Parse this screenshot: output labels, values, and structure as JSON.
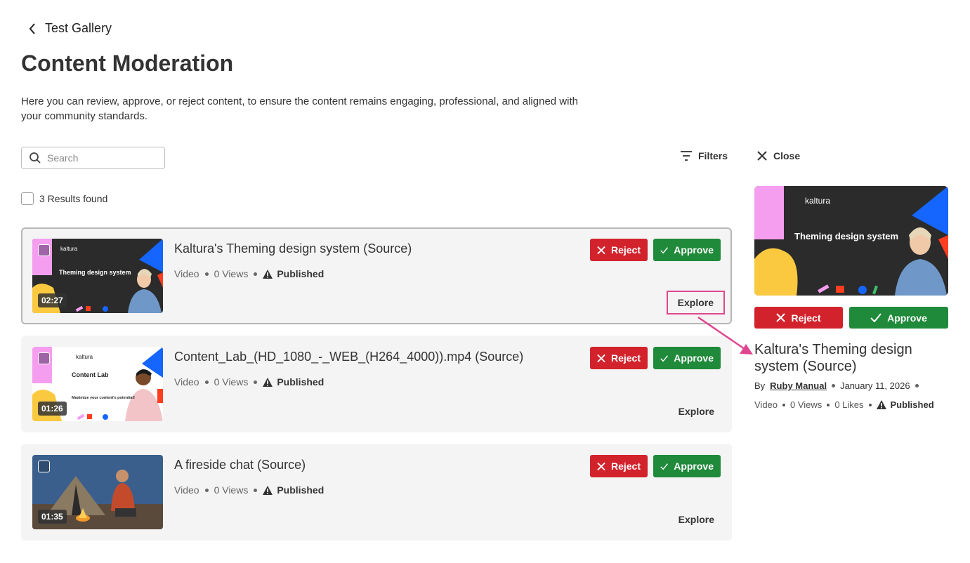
{
  "nav": {
    "back_label": "Test Gallery"
  },
  "page": {
    "title": "Content Moderation",
    "description": "Here you can review, approve, or reject content, to ensure the content remains engaging, professional, and aligned with your community standards."
  },
  "toolbar": {
    "search_placeholder": "Search",
    "filters_label": "Filters",
    "close_label": "Close",
    "results_label": "3 Results found"
  },
  "items": [
    {
      "title": "Kaltura's Theming design system (Source)",
      "type": "Video",
      "views": "0 Views",
      "status": "Published",
      "duration": "02:27",
      "thumb_brand": "kaltura",
      "thumb_caption": "Theming design system",
      "reject_label": "Reject",
      "approve_label": "Approve",
      "explore_label": "Explore"
    },
    {
      "title": "Content_Lab_(HD_1080_-_WEB_(H264_4000)).mp4 (Source)",
      "type": "Video",
      "views": "0 Views",
      "status": "Published",
      "duration": "01:26",
      "thumb_brand": "kaltura",
      "thumb_caption": "Content Lab",
      "thumb_subcaption": "Maximize your content's potential!",
      "reject_label": "Reject",
      "approve_label": "Approve",
      "explore_label": "Explore"
    },
    {
      "title": "A fireside chat (Source)",
      "type": "Video",
      "views": "0 Views",
      "status": "Published",
      "duration": "01:35",
      "reject_label": "Reject",
      "approve_label": "Approve",
      "explore_label": "Explore"
    }
  ],
  "panel": {
    "thumb_brand": "kaltura",
    "thumb_caption": "Theming design system",
    "reject_label": "Reject",
    "approve_label": "Approve",
    "title": "Kaltura's Theming design system (Source)",
    "by_label": "By",
    "author": "Ruby Manual",
    "date": "January 11, 2026",
    "type": "Video",
    "views": "0 Views",
    "likes": "0 Likes",
    "status": "Published"
  },
  "colors": {
    "reject": "#d2232d",
    "approve": "#1f8a3a",
    "highlight": "#e0468f",
    "card_bg": "#f4f4f4"
  }
}
